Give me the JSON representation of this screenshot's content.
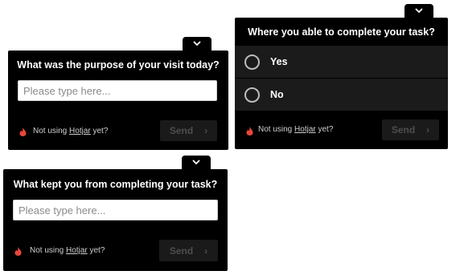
{
  "widget_purpose": {
    "question": "What was the purpose of your visit today?",
    "input_placeholder": "Please type here...",
    "promo_prefix": "Not using ",
    "promo_link": "Hotjar",
    "promo_suffix": " yet?",
    "send_label": "Send",
    "send_chevron": "›"
  },
  "widget_complete": {
    "question": "Where you able to complete your task?",
    "options": [
      {
        "label": "Yes"
      },
      {
        "label": "No"
      }
    ],
    "promo_prefix": "Not using ",
    "promo_link": "Hotjar",
    "promo_suffix": " yet?",
    "send_label": "Send",
    "send_chevron": "›"
  },
  "widget_kept": {
    "question": "What kept you from completing your task?",
    "input_placeholder": "Please type here...",
    "promo_prefix": "Not using ",
    "promo_link": "Hotjar",
    "promo_suffix": " yet?",
    "send_label": "Send",
    "send_chevron": "›"
  },
  "colors": {
    "panel_background": "#000000",
    "option_background": "#1b1b1b",
    "send_background": "#1a1a1a",
    "fire_icon": "#e8473b"
  },
  "icons": {
    "collapse": "chevron-down-icon",
    "brand": "fire-icon"
  }
}
